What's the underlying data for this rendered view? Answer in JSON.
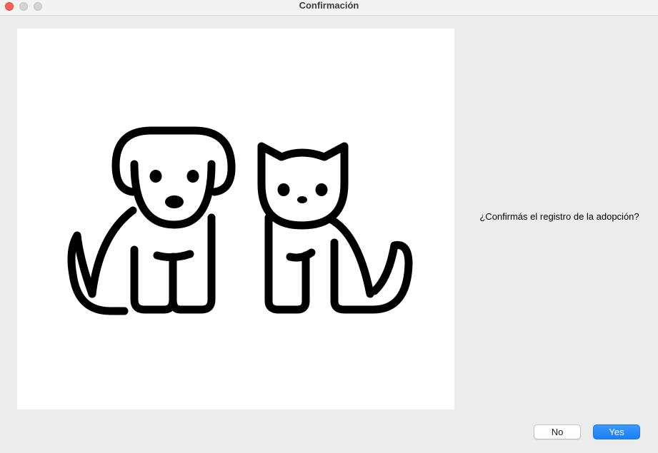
{
  "window": {
    "title": "Confirmación"
  },
  "image": {
    "subject": "dog-and-cat-outline-illustration"
  },
  "dialog": {
    "message": "¿Confirmás el registro de la adopción?"
  },
  "buttons": {
    "no_label": "No",
    "yes_label": "Yes"
  },
  "colors": {
    "close": "#ff5f57",
    "accent": "#1b7ef5",
    "window_bg": "#ececec"
  }
}
